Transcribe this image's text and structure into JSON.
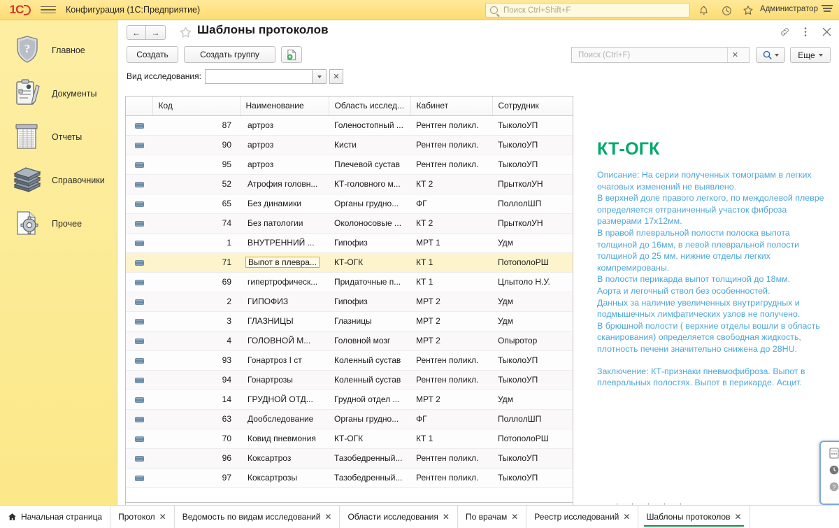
{
  "titlebar": {
    "logo": "1C",
    "app_title": "Конфигурация  (1С:Предприятие)",
    "search_placeholder": "Поиск Ctrl+Shift+F",
    "search_value": "",
    "user": "Администратор",
    "icons": [
      "bell-icon",
      "history-icon",
      "star-icon",
      "main-menu-icon"
    ]
  },
  "sidebar": {
    "items": [
      {
        "label": "Главное",
        "icon": "shield-question-icon"
      },
      {
        "label": "Документы",
        "icon": "clipboard-pen-icon"
      },
      {
        "label": "Отчеты",
        "icon": "report-sheet-icon"
      },
      {
        "label": "Справочники",
        "icon": "books-stack-icon"
      },
      {
        "label": "Прочее",
        "icon": "page-gear-icon"
      }
    ]
  },
  "form": {
    "title": "Шаблоны протоколов",
    "nav_back": "←",
    "nav_forward": "→",
    "favorite_icon": "star-outline-icon",
    "header_icons": [
      "link-icon",
      "kebab-menu-icon",
      "close-icon"
    ],
    "commands": {
      "create": "Создать",
      "create_group": "Создать группу",
      "export_icon": "page-add-icon"
    },
    "filter": {
      "label": "Вид исследования:",
      "value": "",
      "dropdown_icon": "chevron-down-icon",
      "clear_icon": "clear-icon"
    },
    "search": {
      "placeholder": "Поиск (Ctrl+F)",
      "value": "",
      "clear_icon": "clear-icon",
      "find_icon": "search-icon",
      "more_label": "Еще"
    }
  },
  "table": {
    "columns": [
      "Код",
      "Наименование",
      "Область исслед...",
      "Кабинет",
      "Сотрудник"
    ],
    "rows": [
      {
        "code": "87",
        "name": "артроз",
        "area": "Голеностопный ...",
        "room": "Рентген поликл.",
        "staff": "ТыколоУП",
        "selected": false
      },
      {
        "code": "90",
        "name": "артроз",
        "area": "Кисти",
        "room": "Рентген поликл.",
        "staff": "ТыколоУП",
        "selected": false
      },
      {
        "code": "95",
        "name": "артроз",
        "area": "Плечевой сустав",
        "room": "Рентген поликл.",
        "staff": "ТыколоУП",
        "selected": false
      },
      {
        "code": "52",
        "name": "Атрофия головн...",
        "area": "КТ-головного м...",
        "room": "КТ 2",
        "staff": "ПрытколУН",
        "selected": false
      },
      {
        "code": "65",
        "name": "Без динамики",
        "area": "Органы грудно...",
        "room": "ФГ",
        "staff": "ПоллолШП",
        "selected": false
      },
      {
        "code": "74",
        "name": "Без патологии",
        "area": "Околоносовые ...",
        "room": "КТ 2",
        "staff": "ПрытколУН",
        "selected": false
      },
      {
        "code": "1",
        "name": "ВНУТРЕННИЙ ...",
        "area": "Гипофиз",
        "room": "МРТ 1",
        "staff": "Удм",
        "selected": false
      },
      {
        "code": "71",
        "name": "Выпот в плевра...",
        "area": "КТ-ОГК",
        "room": "КТ 1",
        "staff": "ПотополоРШ",
        "selected": true
      },
      {
        "code": "69",
        "name": "гипертрофическ...",
        "area": "Придаточные п...",
        "room": "КТ 1",
        "staff": "Цлытоло Н.У.",
        "selected": false
      },
      {
        "code": "2",
        "name": "ГИПОФИЗ",
        "area": "Гипофиз",
        "room": "МРТ 2",
        "staff": "Удм",
        "selected": false
      },
      {
        "code": "3",
        "name": "ГЛАЗНИЦЫ",
        "area": "Глазницы",
        "room": "МРТ 2",
        "staff": "Удм",
        "selected": false
      },
      {
        "code": "4",
        "name": "ГОЛОВНОЙ М...",
        "area": "Головной мозг",
        "room": "МРТ 2",
        "staff": "Опыротор",
        "selected": false
      },
      {
        "code": "93",
        "name": "Гонартроз I ст",
        "area": "Коленный сустав",
        "room": "Рентген поликл.",
        "staff": "ТыколоУП",
        "selected": false
      },
      {
        "code": "94",
        "name": "Гонартрозы",
        "area": "Коленный сустав",
        "room": "Рентген поликл.",
        "staff": "ТыколоУП",
        "selected": false
      },
      {
        "code": "14",
        "name": "ГРУДНОЙ ОТД...",
        "area": "Грудной отдел ...",
        "room": "МРТ 2",
        "staff": "Удм",
        "selected": false
      },
      {
        "code": "63",
        "name": "Дообследование",
        "area": "Органы грудно...",
        "room": "ФГ",
        "staff": "ПоллолШП",
        "selected": false
      },
      {
        "code": "70",
        "name": "Ковид пневмония",
        "area": "КТ-ОГК",
        "room": "КТ 1",
        "staff": "ПотополоРШ",
        "selected": false
      },
      {
        "code": "96",
        "name": "Коксартроз",
        "area": "Тазобедренный...",
        "room": "Рентген поликл.",
        "staff": "ТыколоУП",
        "selected": false
      },
      {
        "code": "97",
        "name": "Коксартрозы",
        "area": "Тазобедренный...",
        "room": "Рентген поликл.",
        "staff": "ТыколоУП",
        "selected": false
      }
    ],
    "row_nav": [
      "⤒",
      "▲",
      "▼",
      "⤓"
    ]
  },
  "preview": {
    "heading": "КТ-ОГК",
    "heading_color": "#00a86b",
    "text_color": "#4da6d9",
    "description": "Описание: На серии полученных томограмм в легких очаговых  изменений не выявлено.\nВ верхней доле правого легкого, по междолевой плевре определяется отграниченный участок фиброза размерами 17х12мм.\nВ правой плевральной полости полоска выпота толщиной до 16мм, в левой плевральной полости толщиной до 25 мм, нижние отделы легких компремированы.\nВ полости перикарда выпот толщиной до 18мм.\nАорта и легочный ствол без особенностей.\nДанных за наличие увеличенных внутригрудных и подмышечных лимфатических узлов не получено.\nВ брюшной полости ( верхние отделы вошли в область сканирования) определяется свободная жидкость, плотность печени значительно снижена до 28HU.",
    "conclusion": "Заключение: КТ-признаки пневмофиброза. Выпот в плевральных полостях.  Выпот в перикарде. Асцит."
  },
  "taskbar": {
    "tabs": [
      {
        "label": "Начальная страница",
        "closable": false,
        "active": false,
        "icon": "home-icon"
      },
      {
        "label": "Протокол",
        "closable": true,
        "active": false
      },
      {
        "label": "Ведомость по видам исследований",
        "closable": true,
        "active": false
      },
      {
        "label": "Области исследования",
        "closable": true,
        "active": false
      },
      {
        "label": "По врачам",
        "closable": true,
        "active": false
      },
      {
        "label": "Реестр исследований",
        "closable": true,
        "active": false
      },
      {
        "label": "Шаблоны протоколов",
        "closable": true,
        "active": true
      }
    ],
    "close_glyph": "✕"
  }
}
